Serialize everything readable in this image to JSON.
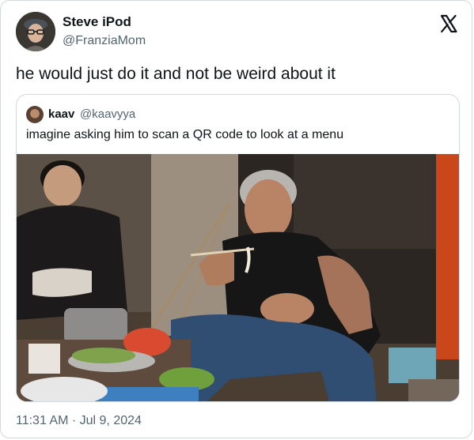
{
  "author": {
    "display_name": "Steve iPod",
    "handle": "@FranziaMom"
  },
  "tweet": {
    "text": "he would just do it and not be weird about it",
    "timestamp": "11:31 AM · Jul 9, 2024"
  },
  "quoted": {
    "display_name": "kaav",
    "handle": "@kaavyya",
    "text": "imagine asking him to scan a QR code to look at a menu"
  },
  "icons": {
    "logo": "x-logo-icon"
  },
  "colors": {
    "text_primary": "#0f1419",
    "text_secondary": "#536471",
    "border": "#cfd9de"
  }
}
